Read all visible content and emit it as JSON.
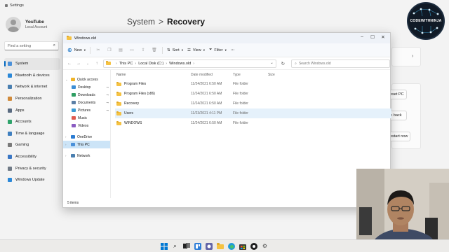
{
  "settings": {
    "window_title": "Settings",
    "profile": {
      "name": "YouTube",
      "account": "Local Account"
    },
    "search_placeholder": "Find a setting",
    "nav": [
      {
        "label": "System",
        "icon": "system-icon",
        "color": "#4a90d9",
        "active": true
      },
      {
        "label": "Bluetooth & devices",
        "icon": "bluetooth-icon",
        "color": "#2b88d8"
      },
      {
        "label": "Network & internet",
        "icon": "network-icon",
        "color": "#4a7fb0"
      },
      {
        "label": "Personalization",
        "icon": "personalization-icon",
        "color": "#d08a3b"
      },
      {
        "label": "Apps",
        "icon": "apps-icon",
        "color": "#5a6b80"
      },
      {
        "label": "Accounts",
        "icon": "accounts-icon",
        "color": "#2fa36b"
      },
      {
        "label": "Time & language",
        "icon": "time-language-icon",
        "color": "#3f7fbf"
      },
      {
        "label": "Gaming",
        "icon": "gaming-icon",
        "color": "#7a7a7a"
      },
      {
        "label": "Accessibility",
        "icon": "accessibility-icon",
        "color": "#3a76c4"
      },
      {
        "label": "Privacy & security",
        "icon": "privacy-icon",
        "color": "#707a86"
      },
      {
        "label": "Windows Update",
        "icon": "windows-update-icon",
        "color": "#2b88d8"
      }
    ],
    "breadcrumb": {
      "parent": "System",
      "separator": ">",
      "current": "Recovery"
    },
    "buttons": {
      "reset_pc": "Reset PC",
      "go_back": "Go back",
      "restart_now": "Restart now"
    }
  },
  "explorer": {
    "title": "Windows.old",
    "toolbar": {
      "new": "New",
      "sort": "Sort",
      "view": "View",
      "filter": "Filter",
      "more": "···"
    },
    "address": [
      "This PC",
      "Local Disk (C:)",
      "Windows.old"
    ],
    "search_placeholder": "Search Windows.old",
    "nav": [
      {
        "label": "Quick access",
        "icon": "star-icon",
        "color": "#f0b429",
        "expanded": true,
        "level": 0
      },
      {
        "label": "Desktop",
        "icon": "desktop-icon",
        "color": "#3b8ed6",
        "pinned": true,
        "level": 1
      },
      {
        "label": "Downloads",
        "icon": "downloads-icon",
        "color": "#2f9e63",
        "pinned": true,
        "level": 1
      },
      {
        "label": "Documents",
        "icon": "documents-icon",
        "color": "#5b7fa6",
        "pinned": true,
        "level": 1
      },
      {
        "label": "Pictures",
        "icon": "pictures-icon",
        "color": "#3a9bd5",
        "pinned": true,
        "level": 1
      },
      {
        "label": "Music",
        "icon": "music-icon",
        "color": "#e05a4f",
        "level": 1
      },
      {
        "label": "Videos",
        "icon": "videos-icon",
        "color": "#8a5cc2",
        "level": 1
      },
      {
        "label": "OneDrive",
        "icon": "onedrive-icon",
        "color": "#2b7cd3",
        "level": 0
      },
      {
        "label": "This PC",
        "icon": "this-pc-icon",
        "color": "#4a90d9",
        "selected": true,
        "level": 0
      },
      {
        "label": "Network",
        "icon": "network-icon",
        "color": "#4a7fb0",
        "level": 0
      }
    ],
    "columns": {
      "name": "Name",
      "date": "Date modified",
      "type": "Type",
      "size": "Size"
    },
    "rows": [
      {
        "name": "Program Files",
        "date": "11/24/2021 6:50 AM",
        "type": "File folder"
      },
      {
        "name": "Program Files (x86)",
        "date": "11/24/2021 6:50 AM",
        "type": "File folder"
      },
      {
        "name": "Recovery",
        "date": "11/24/2021 6:50 AM",
        "type": "File folder"
      },
      {
        "name": "Users",
        "date": "11/23/2021 4:11 PM",
        "type": "File folder",
        "hover": true
      },
      {
        "name": "WINDOWS",
        "date": "11/24/2021 6:50 AM",
        "type": "File folder"
      }
    ],
    "status": "5 items"
  },
  "logo": {
    "text": "CODEWITHNINJA",
    "accent": "#3ea7d8"
  },
  "colors": {
    "folder": "#f5c242",
    "selection": "#cce4f7",
    "hover": "#e5f1fb",
    "accent": "#0067c0"
  }
}
